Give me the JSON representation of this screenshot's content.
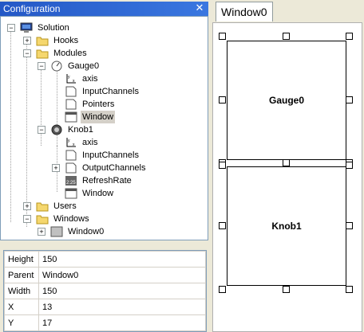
{
  "panel": {
    "title": "Configuration",
    "close_label": "✕"
  },
  "tree": {
    "solution": "Solution",
    "hooks": "Hooks",
    "modules": "Modules",
    "gauge0": "Gauge0",
    "gauge0_axis": "axis",
    "gauge0_input": "InputChannels",
    "gauge0_pointers": "Pointers",
    "gauge0_window": "Window",
    "knob1": "Knob1",
    "knob1_axis": "axis",
    "knob1_input": "InputChannels",
    "knob1_output": "OutputChannels",
    "knob1_refresh": "RefreshRate",
    "knob1_window": "Window",
    "users": "Users",
    "windows": "Windows",
    "window0": "Window0",
    "icons": [
      "computer-icon",
      "folder-icon",
      "gauge-icon",
      "knob-icon",
      "axis-icon",
      "document-icon",
      "window-icon",
      "clock-icon"
    ],
    "refresh_icon_text": "2:25"
  },
  "properties": [
    {
      "key": "Height",
      "value": "150"
    },
    {
      "key": "Parent",
      "value": "Window0"
    },
    {
      "key": "Width",
      "value": "150"
    },
    {
      "key": "X",
      "value": "13"
    },
    {
      "key": "Y",
      "value": "17"
    }
  ],
  "designer": {
    "tab_label": "Window0",
    "widgets": [
      {
        "label": "Gauge0"
      },
      {
        "label": "Knob1"
      }
    ]
  }
}
